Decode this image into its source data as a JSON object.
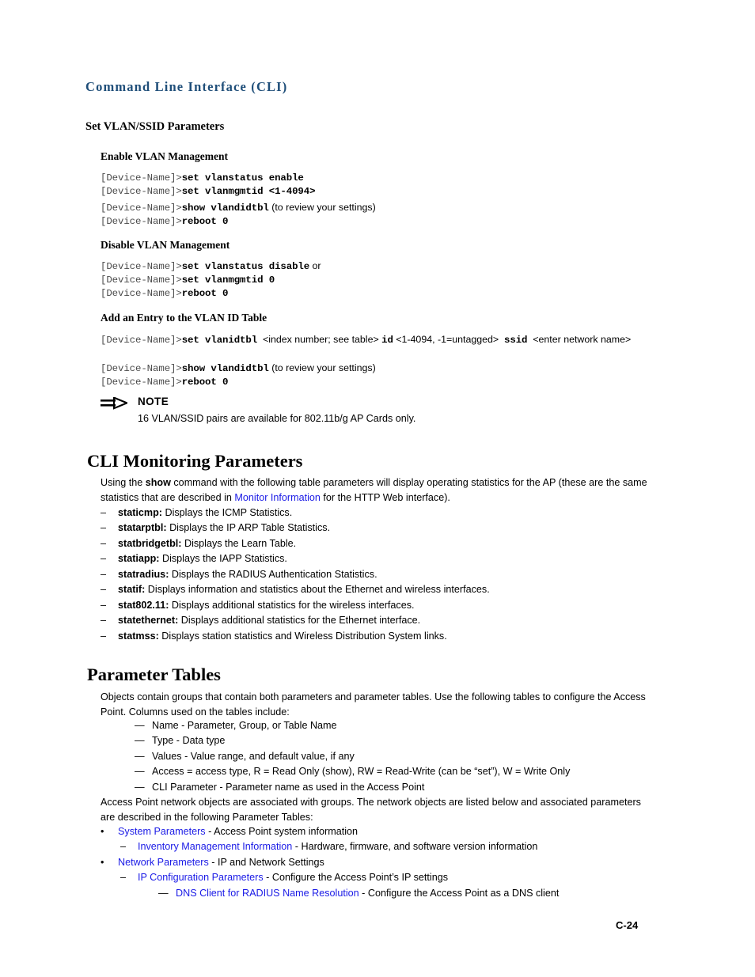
{
  "page": {
    "running_header": "Command Line Interface (CLI)",
    "footer_page_number": "C-24",
    "link_color": "#1a1ae6",
    "header_color": "#1f4e79"
  },
  "set_vlan_section": {
    "heading": "Set VLAN/SSID Parameters",
    "enable_vlan": {
      "heading": "Enable VLAN Management",
      "lines": [
        {
          "prompt": "[Device-Name]>",
          "command": "set vlanstatus enable",
          "note": ""
        },
        {
          "prompt": "[Device-Name]>",
          "command": "set vlanmgmtid <1-4094>",
          "note": ""
        },
        {
          "prompt": "[Device-Name]>",
          "command": "show vlandidtbl",
          "note": " (to review your settings)"
        },
        {
          "prompt": "[Device-Name]>",
          "command": "reboot 0",
          "note": ""
        }
      ]
    },
    "disable_vlan": {
      "heading": "Disable VLAN Management",
      "lines": [
        {
          "prompt": "[Device-Name]>",
          "command": "set vlanstatus disable",
          "note": " or"
        },
        {
          "prompt": "[Device-Name]>",
          "command": "set vlanmgmtid 0",
          "note": ""
        },
        {
          "prompt": "[Device-Name]>",
          "command": "reboot 0",
          "note": ""
        }
      ]
    },
    "add_entry": {
      "heading": "Add an Entry to the VLAN ID Table",
      "wrapped_line": {
        "prompt": "[Device-Name]>",
        "command1": "set vlanidtbl",
        "placeholder1": "<index number; see table>",
        "command2": "id",
        "placeholder2": "<1-4094, -1=untagged>",
        "command3": "ssid",
        "placeholder3": "<enter network name>"
      },
      "lines": [
        {
          "prompt": "[Device-Name]>",
          "command": "show vlandidtbl",
          "note": " (to review your settings)"
        },
        {
          "prompt": "[Device-Name]>",
          "command": "reboot 0",
          "note": ""
        }
      ]
    },
    "note": {
      "icon": "note-arrow-icon",
      "title": "NOTE",
      "text": "16 VLAN/SSID pairs are available for 802.11b/g AP Cards only."
    }
  },
  "cli_monitoring": {
    "heading": "CLI Monitoring Parameters",
    "intro_part1": "Using the ",
    "intro_bold": "show",
    "intro_part2": " command with the following table parameters will display operating statistics for the AP (these are the same statistics that are described in ",
    "intro_link": "Monitor Information",
    "intro_part3": " for the HTTP Web interface).",
    "items": [
      {
        "marker": "–",
        "name": "staticmp:",
        "desc": " Displays the ICMP Statistics."
      },
      {
        "marker": "–",
        "name": "statarptbl:",
        "desc": " Displays the IP ARP Table Statistics."
      },
      {
        "marker": "–",
        "name": "statbridgetbl:",
        "desc": " Displays the Learn Table."
      },
      {
        "marker": "–",
        "name": "statiapp:",
        "desc": " Displays the IAPP Statistics."
      },
      {
        "marker": "–",
        "name": "statradius:",
        "desc": " Displays the RADIUS Authentication Statistics."
      },
      {
        "marker": "–",
        "name": "statif:",
        "desc": " Displays information and statistics about the Ethernet and wireless interfaces."
      },
      {
        "marker": "–",
        "name": "stat802.11:",
        "desc": " Displays additional statistics for the wireless interfaces."
      },
      {
        "marker": "–",
        "name": "statethernet:",
        "desc": " Displays additional statistics for the Ethernet interface."
      },
      {
        "marker": "–",
        "name": "statmss:",
        "desc": " Displays station statistics and Wireless Distribution System links."
      }
    ]
  },
  "parameter_tables": {
    "heading": "Parameter Tables",
    "intro": "Objects contain groups that contain both parameters and parameter tables. Use the following tables to configure the Access Point. Columns used on the tables include:",
    "columns": [
      {
        "marker": "—",
        "text": "Name - Parameter, Group, or Table Name"
      },
      {
        "marker": "—",
        "text": "Type - Data type"
      },
      {
        "marker": "—",
        "text": "Values - Value range, and default value, if any"
      },
      {
        "marker": "—",
        "text": "Access = access type, R = Read Only (show), RW = Read-Write (can be “set”), W = Write Only"
      },
      {
        "marker": "—",
        "text": "CLI Parameter - Parameter name as used in the Access Point"
      }
    ],
    "objects_intro": "Access Point network objects are associated with groups. The network objects are listed below and associated parameters are described in the following Parameter Tables:",
    "links": [
      {
        "marker": "•",
        "level": 0,
        "link": "System Parameters",
        "desc": " - Access Point system information"
      },
      {
        "marker": "–",
        "level": 1,
        "link": "Inventory Management Information",
        "desc": " - Hardware, firmware, and software version information"
      },
      {
        "marker": "•",
        "level": 0,
        "link": "Network Parameters",
        "desc": " - IP and Network Settings"
      },
      {
        "marker": "–",
        "level": 1,
        "link": "IP Configuration Parameters",
        "desc": " - Configure the Access Point’s IP settings"
      },
      {
        "marker": "—",
        "level": 2,
        "link": "DNS Client for RADIUS Name Resolution",
        "desc": " - Configure the Access Point as a DNS client"
      }
    ]
  }
}
